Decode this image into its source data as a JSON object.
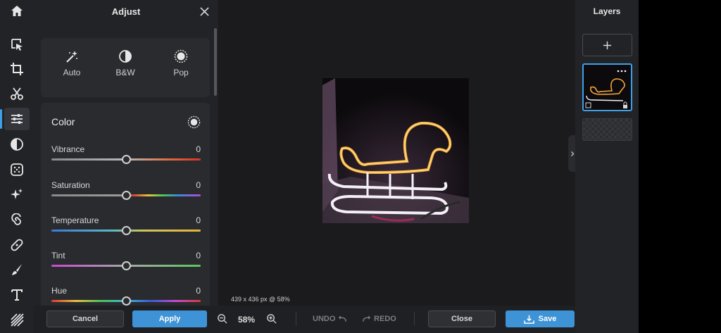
{
  "tools": [
    {
      "name": "home-icon"
    },
    {
      "name": "select-icon"
    },
    {
      "name": "crop-icon"
    },
    {
      "name": "cut-icon"
    },
    {
      "name": "adjust-icon",
      "active": true
    },
    {
      "name": "filter-icon"
    },
    {
      "name": "effects-icon"
    },
    {
      "name": "retouch-icon"
    },
    {
      "name": "liquify-icon"
    },
    {
      "name": "heal-icon"
    },
    {
      "name": "brush-icon"
    },
    {
      "name": "text-icon"
    },
    {
      "name": "texture-icon"
    }
  ],
  "panel": {
    "title": "Adjust",
    "presets": [
      {
        "label": "Auto",
        "icon": "magic-wand-icon"
      },
      {
        "label": "B&W",
        "icon": "contrast-icon"
      },
      {
        "label": "Pop",
        "icon": "pop-icon"
      }
    ],
    "color_section": {
      "title": "Color",
      "sliders": [
        {
          "label": "Vibrance",
          "value": "0",
          "level": 0.5
        },
        {
          "label": "Saturation",
          "value": "0",
          "level": 0.5
        },
        {
          "label": "Temperature",
          "value": "0",
          "level": 0.5
        },
        {
          "label": "Tint",
          "value": "0",
          "level": 0.5
        },
        {
          "label": "Hue",
          "value": "0",
          "level": 0.5
        }
      ]
    }
  },
  "canvas": {
    "size_info": "439 x 436 px @ 58%"
  },
  "layers": {
    "title": "Layers"
  },
  "bottombar": {
    "cancel": "Cancel",
    "apply": "Apply",
    "zoom": "58%",
    "undo": "UNDO",
    "redo": "REDO",
    "close": "Close",
    "save": "Save"
  },
  "colors": {
    "accent": "#3e93d6",
    "panel_bg": "#222326",
    "canvas_bg": "#1b1b1d"
  }
}
